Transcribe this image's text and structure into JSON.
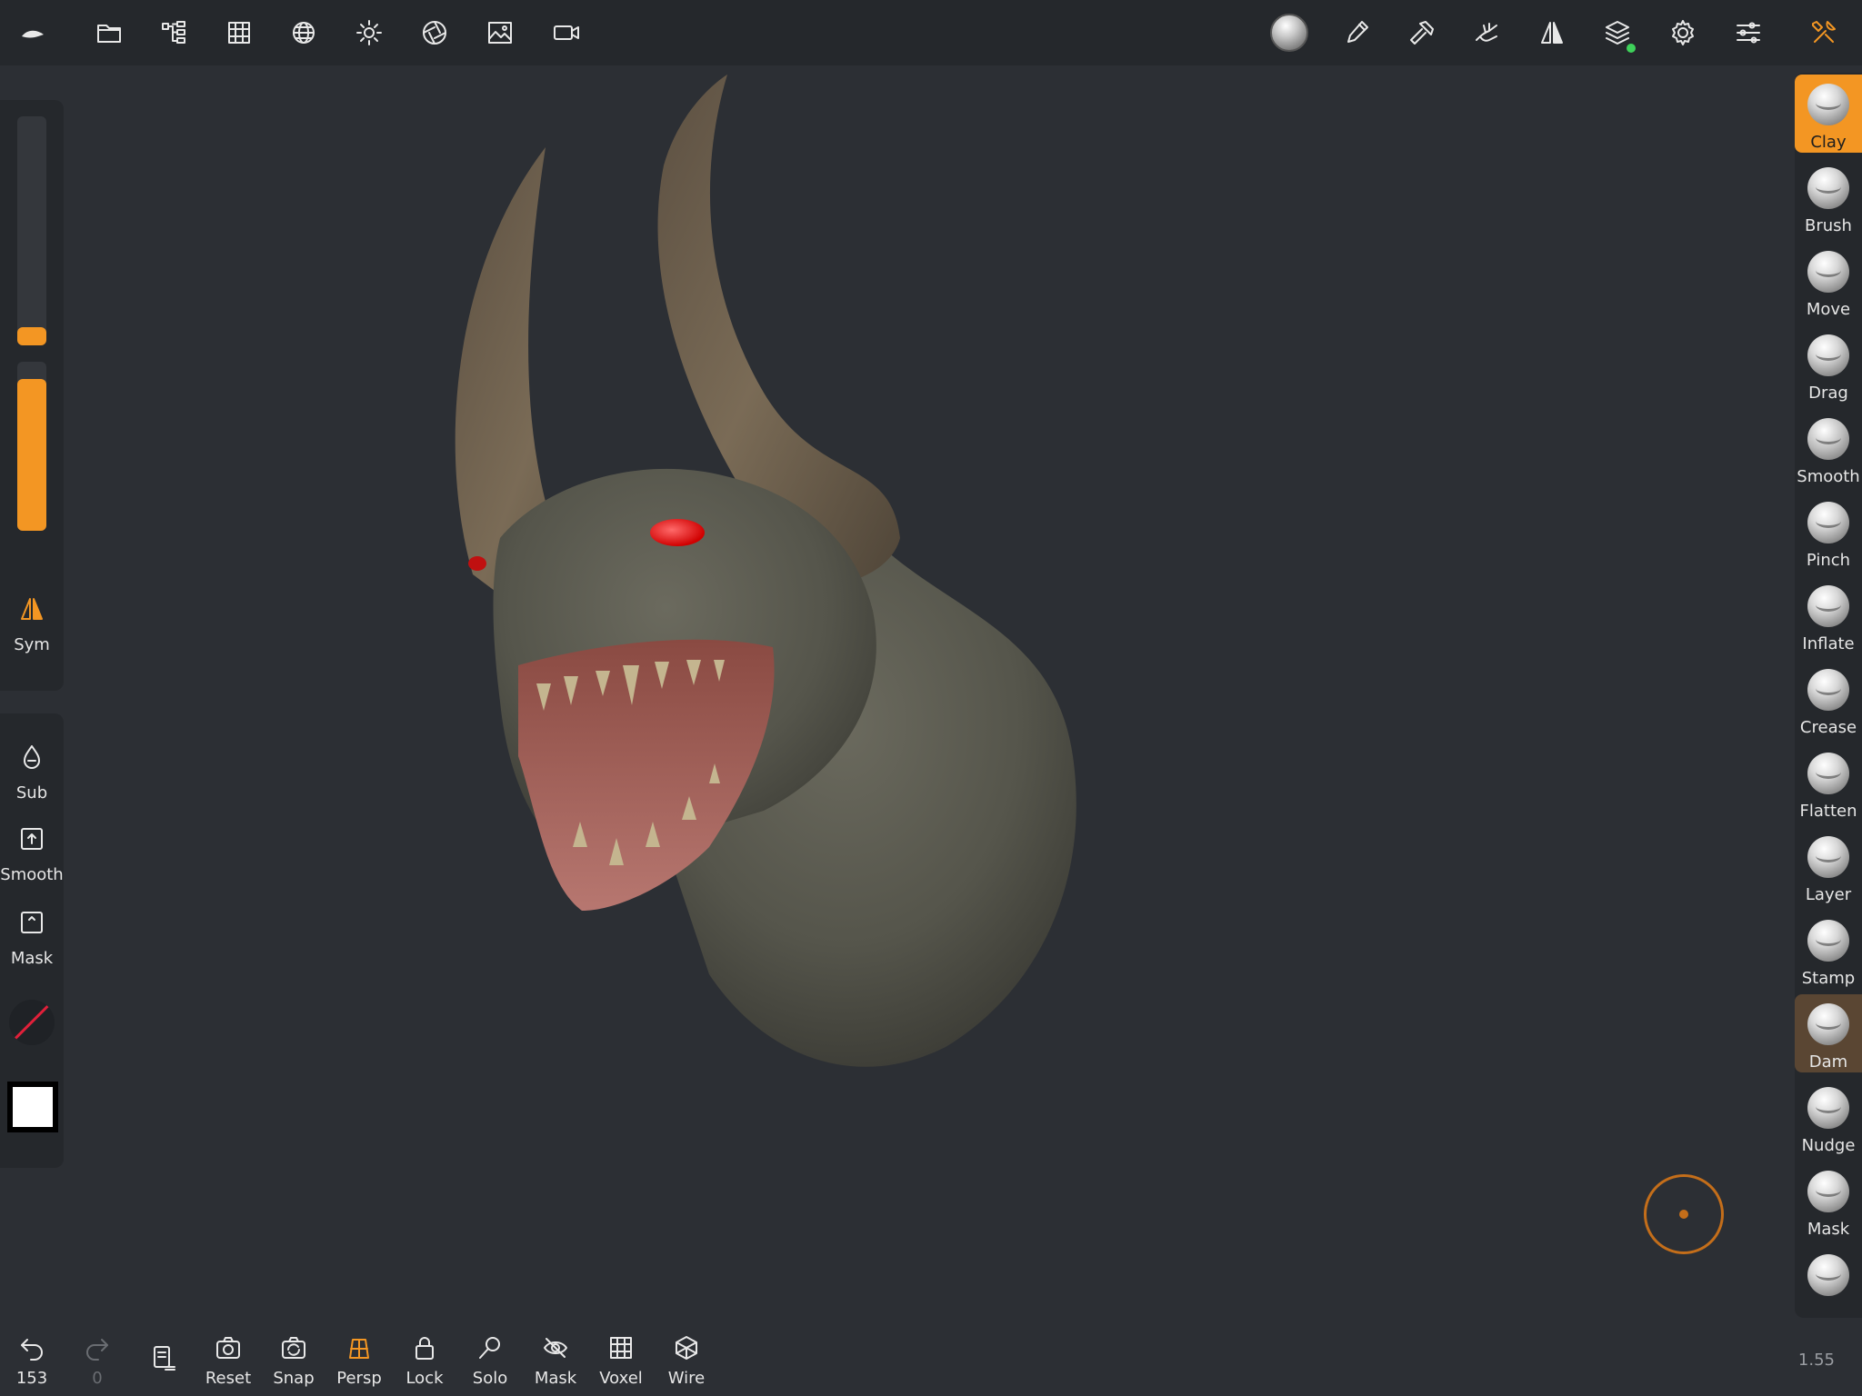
{
  "toolbar": {
    "left_icons": [
      "logo-icon",
      "folder-icon",
      "scene-tree-icon",
      "grid-icon",
      "sphere-mesh-icon",
      "light-icon",
      "aperture-icon",
      "image-icon",
      "camera-icon"
    ],
    "right_icons": [
      "material-icon",
      "paint-icon",
      "hammer-icon",
      "hand-icon",
      "symmetry-icon",
      "layers-icon",
      "gear-icon",
      "sliders-icon",
      "tools-icon"
    ]
  },
  "left_panel": {
    "radius_value": 0.08,
    "intensity_value": 0.9,
    "sym_label": "Sym",
    "sub_label": "Sub",
    "smooth_label": "Smooth",
    "mask_label": "Mask"
  },
  "brushes": [
    {
      "label": "Clay"
    },
    {
      "label": "Brush"
    },
    {
      "label": "Move"
    },
    {
      "label": "Drag"
    },
    {
      "label": "Smooth"
    },
    {
      "label": "Pinch"
    },
    {
      "label": "Inflate"
    },
    {
      "label": "Crease"
    },
    {
      "label": "Flatten"
    },
    {
      "label": "Layer"
    },
    {
      "label": "Stamp"
    },
    {
      "label": "Dam"
    },
    {
      "label": "Nudge"
    },
    {
      "label": "Mask"
    }
  ],
  "bottom": {
    "undo_count": "153",
    "redo_count": "0",
    "reset": "Reset",
    "snap": "Snap",
    "persp": "Persp",
    "lock": "Lock",
    "solo": "Solo",
    "mask": "Mask",
    "voxel": "Voxel",
    "wire": "Wire"
  },
  "zoom": "1.55",
  "colors": {
    "accent": "#f39623",
    "background": "#2c2f34",
    "panel": "#25282c",
    "skin": "#5b5a50",
    "horn": "#6d5e4a",
    "eye": "#ff2020"
  }
}
